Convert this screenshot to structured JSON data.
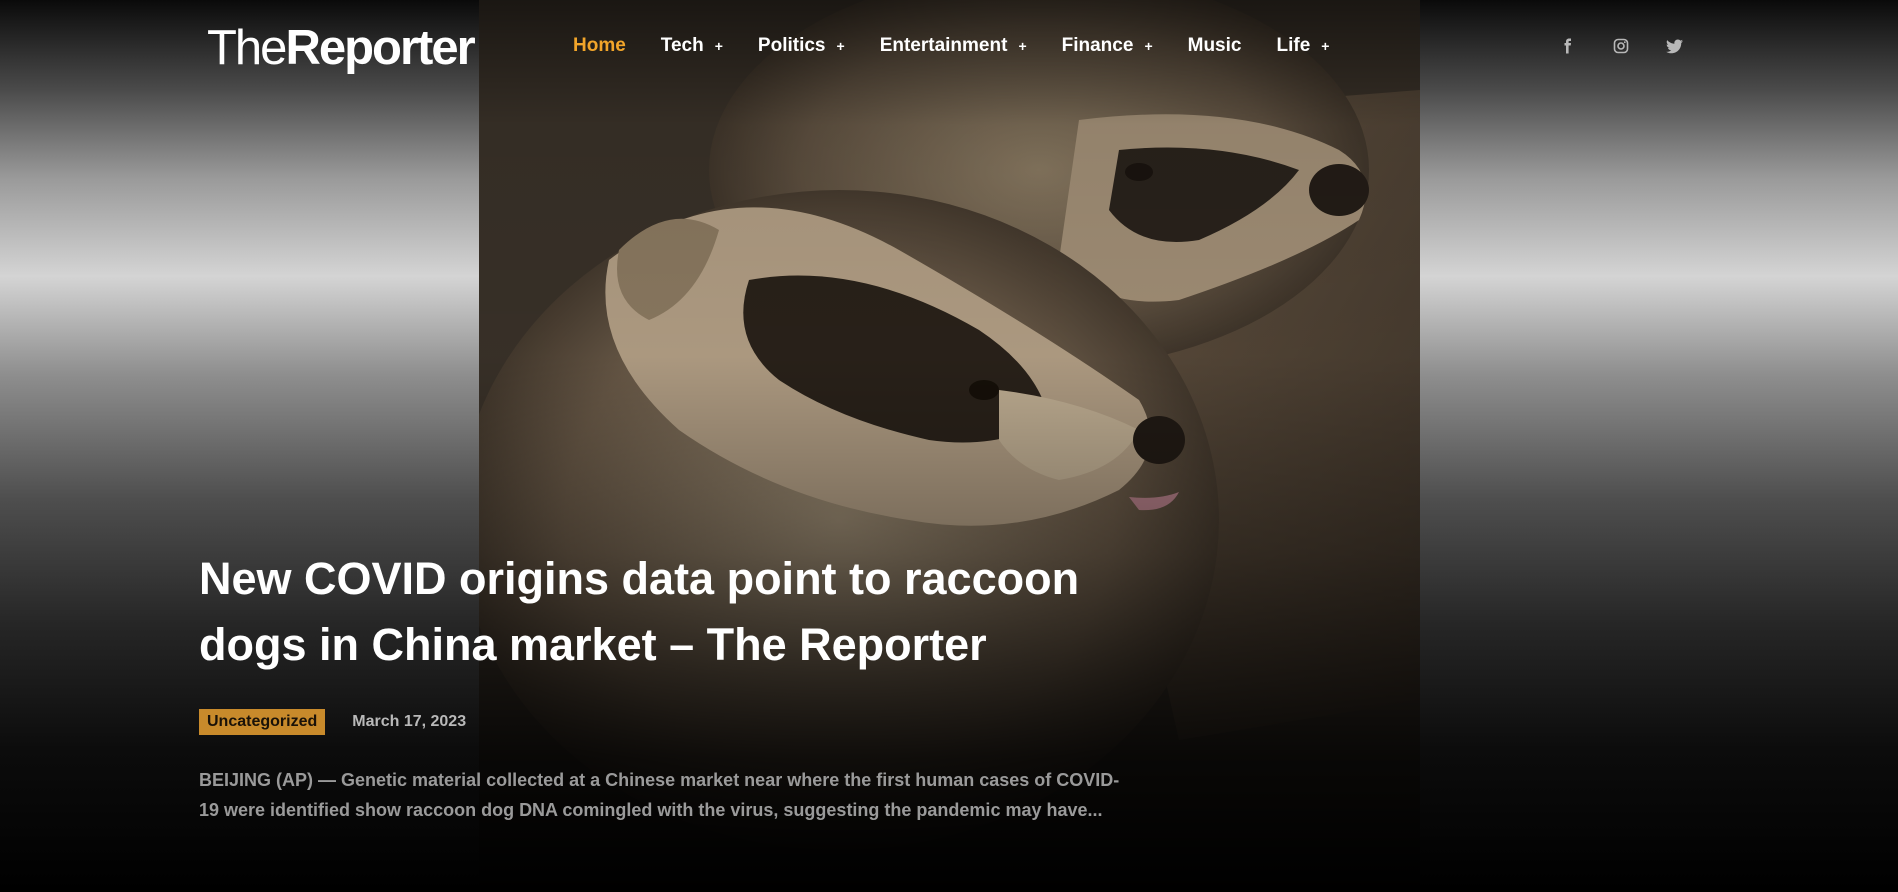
{
  "logo": {
    "part1": "The",
    "part2": "Reporter"
  },
  "nav": {
    "items": [
      {
        "label": "Home",
        "plus": ""
      },
      {
        "label": "Tech",
        "plus": "+"
      },
      {
        "label": "Politics",
        "plus": "+"
      },
      {
        "label": "Entertainment",
        "plus": "+"
      },
      {
        "label": "Finance",
        "plus": "+"
      },
      {
        "label": "Music",
        "plus": ""
      },
      {
        "label": "Life",
        "plus": "+"
      }
    ],
    "active": "Home"
  },
  "social": {
    "icons": [
      "facebook-icon",
      "instagram-icon",
      "twitter-icon"
    ]
  },
  "article": {
    "title": "New COVID origins data point to raccoon dogs in China market – The Reporter",
    "category": "Uncategorized",
    "date": "March 17, 2023",
    "excerpt": "BEIJING (AP) — Genetic material collected at a Chinese market near where the first human cases of COVID-19 were identified show raccoon dog DNA comingled with the virus, suggesting the pandemic may have..."
  },
  "colors": {
    "accent": "#f2a52a",
    "badge": "#c88a2b",
    "text": "#ffffff",
    "muted": "#9a9a9a"
  }
}
